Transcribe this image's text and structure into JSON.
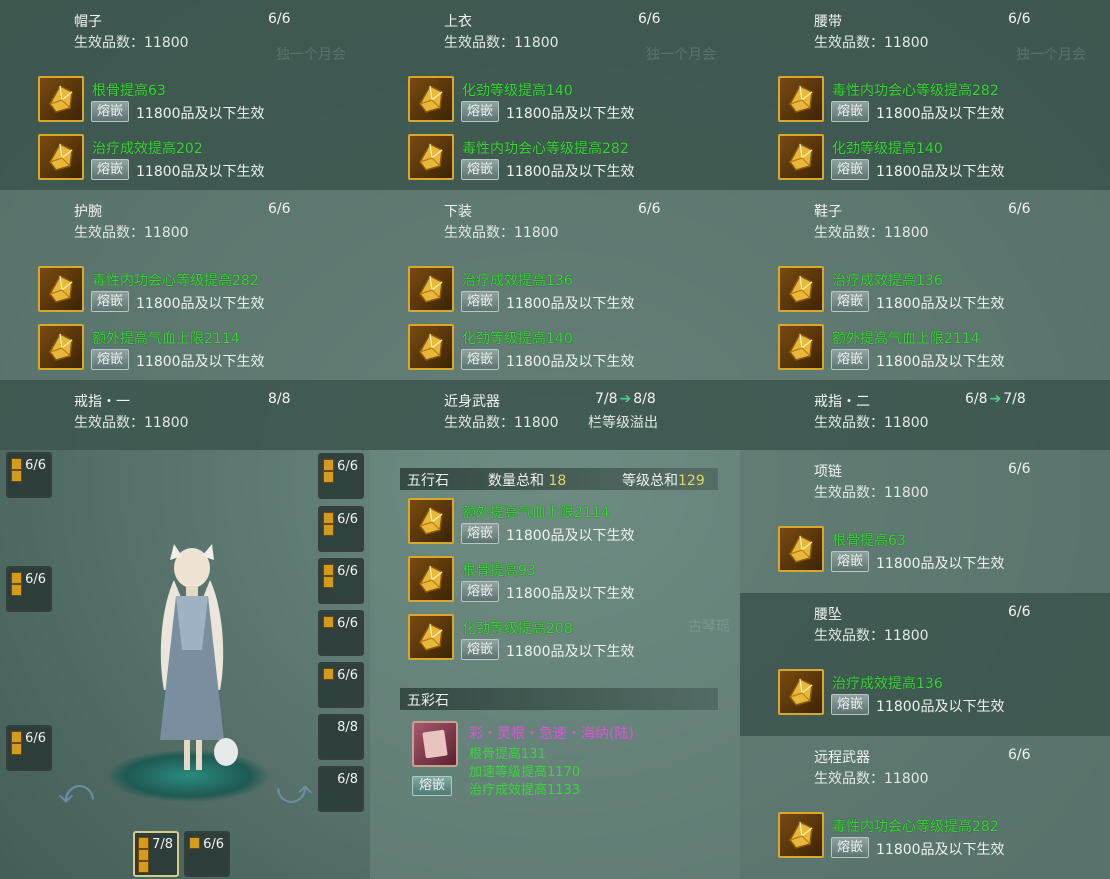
{
  "colors": {
    "stat_green": "#39d53a",
    "gem_gold": "#d7a82a",
    "arrow_green": "#4fd08a",
    "wucai_purple": "#e050e0",
    "sum_yellow": "#e7d45a"
  },
  "labels": {
    "inlay": "熔嵌",
    "rule": "11800品及以下生效"
  },
  "panels": [
    {
      "title": "帽子",
      "count": "6/6",
      "quality": "生效品数：11800",
      "gems": [
        {
          "stat": "根骨提高63"
        },
        {
          "stat": "治疗成效提高202"
        }
      ]
    },
    {
      "title": "上衣",
      "count": "6/6",
      "quality": "生效品数：11800",
      "gems": [
        {
          "stat": "化劲等级提高140"
        },
        {
          "stat": "毒性内功会心等级提高282"
        }
      ]
    },
    {
      "title": "腰带",
      "count": "6/6",
      "quality": "生效品数：11800",
      "gems": [
        {
          "stat": "毒性内功会心等级提高282"
        },
        {
          "stat": "化劲等级提高140"
        }
      ]
    },
    {
      "title": "护腕",
      "count": "6/6",
      "quality": "生效品数：11800",
      "gems": [
        {
          "stat": "毒性内功会心等级提高282"
        },
        {
          "stat": "额外提高气血上限2114"
        }
      ]
    },
    {
      "title": "下装",
      "count": "6/6",
      "quality": "生效品数：11800",
      "gems": [
        {
          "stat": "治疗成效提高136"
        },
        {
          "stat": "化劲等级提高140"
        }
      ]
    },
    {
      "title": "鞋子",
      "count": "6/6",
      "quality": "生效品数：11800",
      "gems": [
        {
          "stat": "治疗成效提高136"
        },
        {
          "stat": "额外提高气血上限2114"
        }
      ]
    },
    {
      "title": "戒指・一",
      "count": "8/8",
      "quality": "生效品数：11800",
      "gems": []
    },
    {
      "title": "近身武器",
      "count_from": "7/8",
      "count_to": "8/8",
      "quality": "生效品数：11800",
      "overflow": "栏等级溢出",
      "gems": []
    },
    {
      "title": "戒指・二",
      "count_from": "6/8",
      "count_to": "7/8",
      "quality": "生效品数：11800",
      "gems": []
    },
    {
      "title": "项链",
      "count": "6/6",
      "quality": "生效品数：11800",
      "gems": [
        {
          "stat": "根骨提高63"
        }
      ]
    },
    {
      "title": "腰坠",
      "count": "6/6",
      "quality": "生效品数：11800",
      "gems": [
        {
          "stat": "治疗成效提高136"
        }
      ]
    },
    {
      "title": "远程武器",
      "count": "6/6",
      "quality": "生效品数：11800",
      "gems": [
        {
          "stat": "毒性内功会心等级提高282"
        }
      ]
    }
  ],
  "wuxing": {
    "label": "五行石",
    "qty_label": "数量总和",
    "qty": "18",
    "lvl_label": "等级总和",
    "lvl": "129",
    "gems": [
      {
        "stat": "额外提高气血上限2114"
      },
      {
        "stat": "根骨提高93"
      },
      {
        "stat": "化劲等级提高208"
      }
    ]
  },
  "wucai": {
    "label": "五彩石",
    "name": "彩・灵根・急速・海纳(陆)",
    "stats": [
      "根骨提高131",
      "加速等级提高1170",
      "治疗成效提高1133"
    ],
    "button": "熔嵌"
  },
  "slots": {
    "left": [
      "6/6",
      "6/6",
      "6/6"
    ],
    "right": [
      "6/6",
      "6/6",
      "6/6",
      "6/6",
      "6/6",
      "8/8",
      "6/8"
    ],
    "bottom": [
      "7/8",
      "6/6"
    ]
  },
  "watermarks": [
    "独一个月会",
    "古琴瑶"
  ]
}
